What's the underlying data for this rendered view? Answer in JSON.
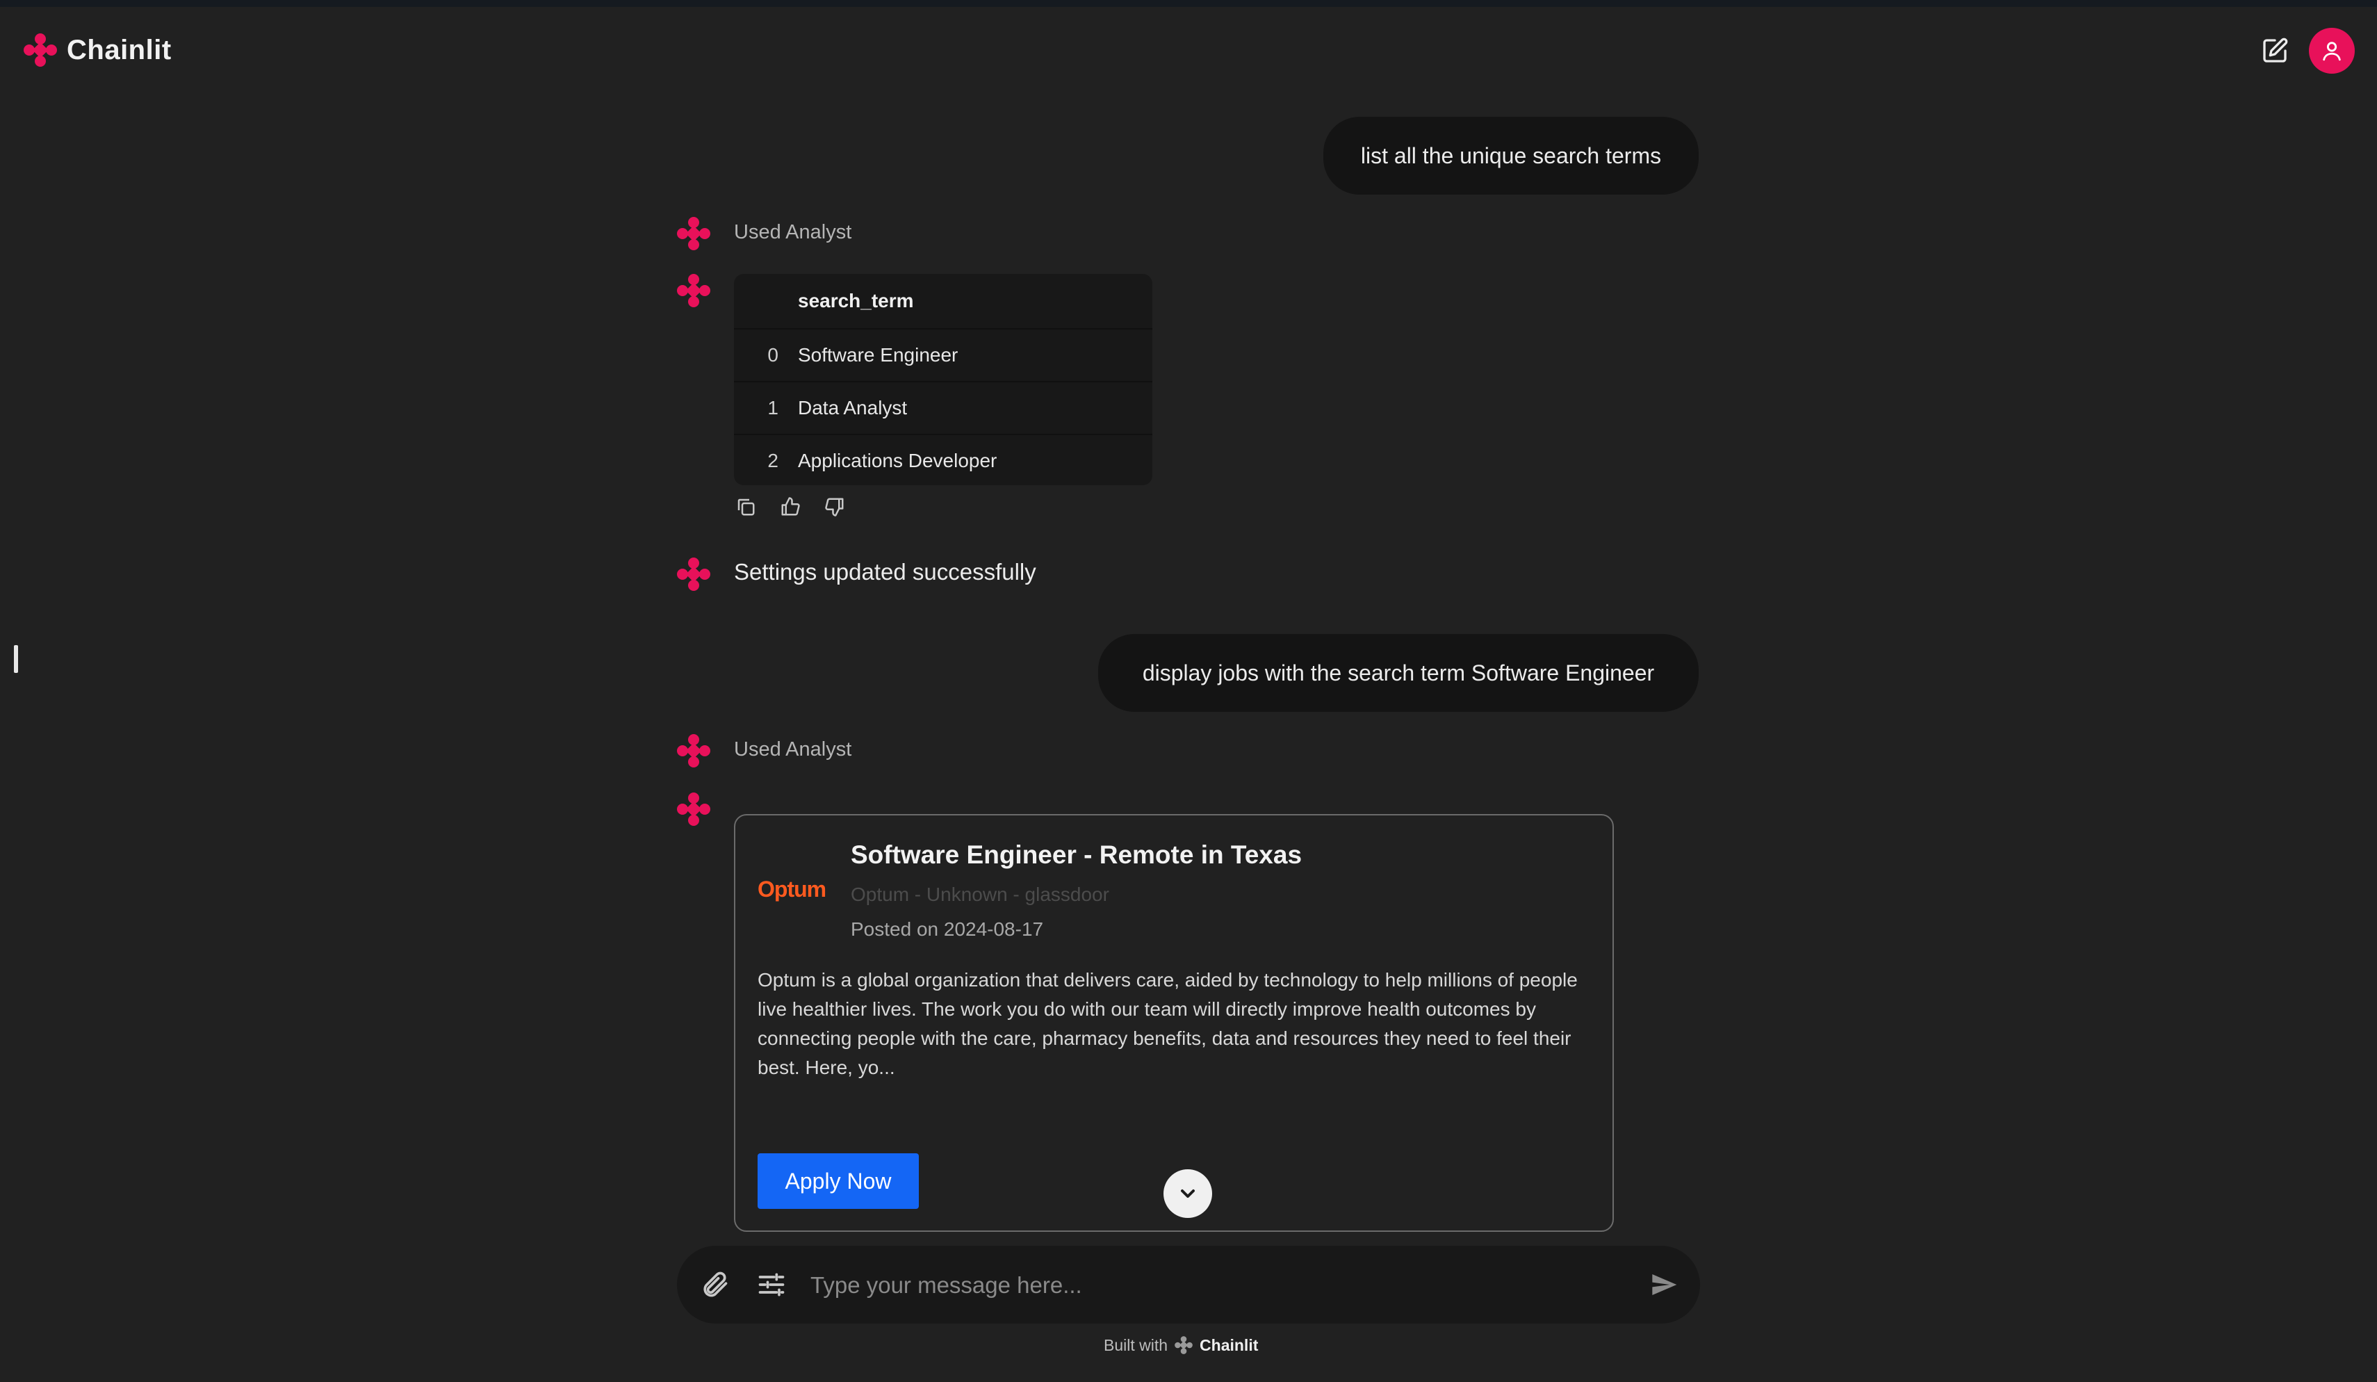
{
  "app": {
    "name": "Chainlit"
  },
  "header": {
    "new_chat_icon": "edit-square-icon",
    "user_icon": "user-icon",
    "accent": "#e8115a"
  },
  "messages": {
    "user_1": "list all the unique search terms",
    "step_1": "Used Analyst",
    "dataframe": {
      "column": "search_term",
      "rows": [
        {
          "index": "0",
          "value": "Software Engineer"
        },
        {
          "index": "1",
          "value": "Data Analyst"
        },
        {
          "index": "2",
          "value": "Applications Developer"
        }
      ]
    },
    "settings_msg": "Settings updated successfully",
    "user_2": "display jobs with the search term Software Engineer",
    "step_2": "Used Analyst",
    "job": {
      "logo_text": "Optum",
      "title": "Software Engineer - Remote in Texas",
      "meta": "Optum - Unknown - glassdoor",
      "posted": "Posted on 2024-08-17",
      "description": "Optum is a global organization that delivers care, aided by technology to help millions of people live healthier lives. The work you do with our team will directly improve health outcomes by connecting people with the care, pharmacy benefits, data and resources they need to feel their best. Here, yo...",
      "apply_label": "Apply Now",
      "apply_color": "#1466f5"
    }
  },
  "composer": {
    "placeholder": "Type your message here..."
  },
  "footer": {
    "built_with": "Built with",
    "brand": "Chainlit"
  }
}
